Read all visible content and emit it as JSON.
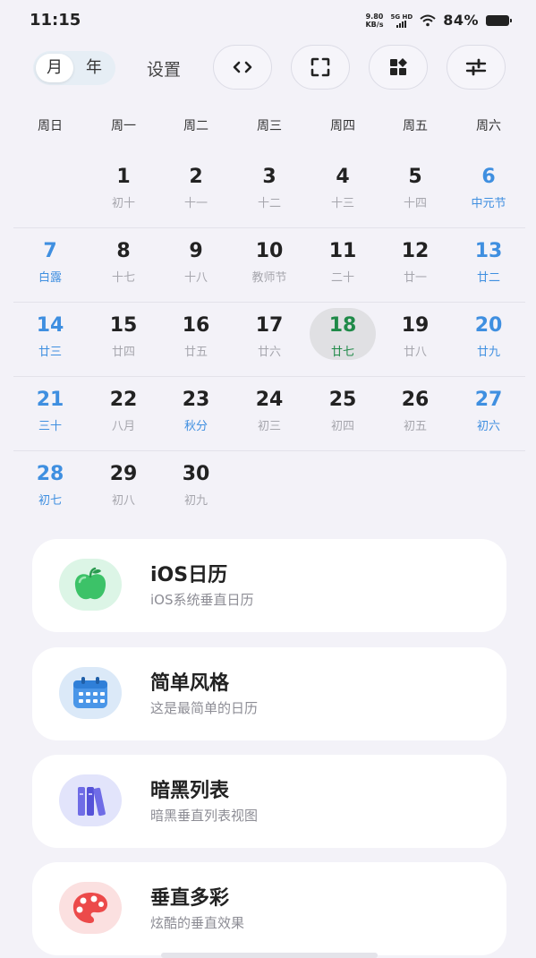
{
  "status": {
    "time": "11:15",
    "speed_value": "9.80",
    "speed_unit": "KB/s",
    "network": "5G HD",
    "battery": "84%"
  },
  "toolbar": {
    "segments": [
      "月",
      "年"
    ],
    "active_segment": "月",
    "settings_label": "设置",
    "icons": [
      "code-icon",
      "fullscreen-icon",
      "widgets-icon",
      "sliders-icon"
    ]
  },
  "calendar": {
    "weekdays": [
      "周日",
      "周一",
      "周二",
      "周三",
      "周四",
      "周五",
      "周六"
    ],
    "today": "18",
    "weeks": [
      [
        null,
        {
          "num": "1",
          "lunar": "初十"
        },
        {
          "num": "2",
          "lunar": "十一"
        },
        {
          "num": "3",
          "lunar": "十二"
        },
        {
          "num": "4",
          "lunar": "十三"
        },
        {
          "num": "5",
          "lunar": "十四"
        },
        {
          "num": "6",
          "lunar": "中元节",
          "weekend": true
        }
      ],
      [
        {
          "num": "7",
          "lunar": "白露",
          "weekend": true
        },
        {
          "num": "8",
          "lunar": "十七"
        },
        {
          "num": "9",
          "lunar": "十八"
        },
        {
          "num": "10",
          "lunar": "教师节"
        },
        {
          "num": "11",
          "lunar": "二十"
        },
        {
          "num": "12",
          "lunar": "廿一"
        },
        {
          "num": "13",
          "lunar": "廿二",
          "weekend": true
        }
      ],
      [
        {
          "num": "14",
          "lunar": "廿三",
          "weekend": true
        },
        {
          "num": "15",
          "lunar": "廿四"
        },
        {
          "num": "16",
          "lunar": "廿五"
        },
        {
          "num": "17",
          "lunar": "廿六"
        },
        {
          "num": "18",
          "lunar": "廿七",
          "today": true
        },
        {
          "num": "19",
          "lunar": "廿八"
        },
        {
          "num": "20",
          "lunar": "廿九",
          "weekend": true
        }
      ],
      [
        {
          "num": "21",
          "lunar": "三十",
          "weekend": true
        },
        {
          "num": "22",
          "lunar": "八月"
        },
        {
          "num": "23",
          "lunar": "秋分",
          "lunar_highlight": true
        },
        {
          "num": "24",
          "lunar": "初三"
        },
        {
          "num": "25",
          "lunar": "初四"
        },
        {
          "num": "26",
          "lunar": "初五"
        },
        {
          "num": "27",
          "lunar": "初六",
          "weekend": true
        }
      ],
      [
        {
          "num": "28",
          "lunar": "初七",
          "weekend": true
        },
        {
          "num": "29",
          "lunar": "初八"
        },
        {
          "num": "30",
          "lunar": "初九"
        },
        null,
        null,
        null,
        null
      ]
    ]
  },
  "styles": [
    {
      "title": "iOS日历",
      "subtitle": "iOS系统垂直日历",
      "icon": "apple-icon",
      "bg": "#dcf5e6"
    },
    {
      "title": "简单风格",
      "subtitle": "这是最简单的日历",
      "icon": "calendar-icon",
      "bg": "#dbe9f8"
    },
    {
      "title": "暗黑列表",
      "subtitle": "暗黑垂直列表视图",
      "icon": "books-icon",
      "bg": "#e2e4fb"
    },
    {
      "title": "垂直多彩",
      "subtitle": "炫酷的垂直效果",
      "icon": "palette-icon",
      "bg": "#fbe0e0"
    }
  ],
  "colors": {
    "weekend": "#3f8fe0",
    "today": "#1f8a48",
    "lunar": "#a6a6ad"
  }
}
